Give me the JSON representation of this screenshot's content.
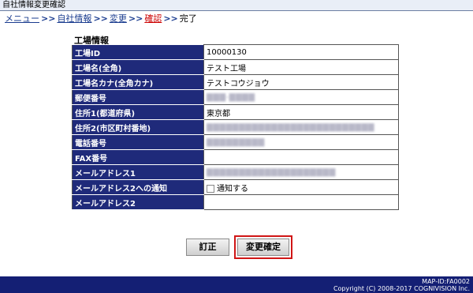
{
  "window": {
    "title": "自社情報変更確認"
  },
  "breadcrumb": {
    "menu": "メニュー",
    "company_info": "自社情報",
    "change": "変更",
    "confirm": "確認",
    "done": "完了",
    "separator": ">>"
  },
  "section": {
    "title": "工場情報"
  },
  "fields": [
    {
      "label": "工場ID",
      "value": "10000130"
    },
    {
      "label": "工場名(全角)",
      "value": "テスト工場"
    },
    {
      "label": "工場名カナ(全角カナ)",
      "value": "テストコウジョウ"
    },
    {
      "label": "郵便番号",
      "value": ""
    },
    {
      "label": "住所1(都道府県)",
      "value": "東京都"
    },
    {
      "label": "住所2(市区町村番地)",
      "value": ""
    },
    {
      "label": "電話番号",
      "value": ""
    },
    {
      "label": "FAX番号",
      "value": ""
    },
    {
      "label": "メールアドレス1",
      "value": ""
    },
    {
      "label": "メールアドレス2への通知",
      "value": "通知する"
    },
    {
      "label": "メールアドレス2",
      "value": ""
    }
  ],
  "buttons": {
    "correct": "訂正",
    "confirm": "変更確定"
  },
  "footer": {
    "screen_id": "MAP-ID:FA0002",
    "copyright": "Copyright (C) 2008-2017 COGNIVISION Inc."
  }
}
